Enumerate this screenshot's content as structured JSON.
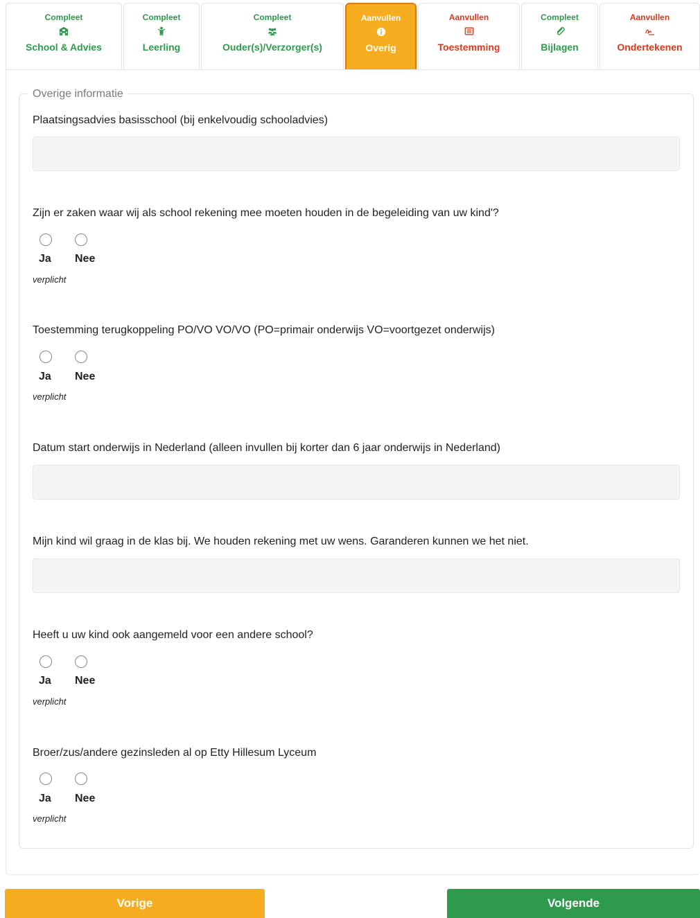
{
  "tabs": [
    {
      "status": "Compleet",
      "label": "School & Advies",
      "icon": "school-icon",
      "state": "done"
    },
    {
      "status": "Compleet",
      "label": "Leerling",
      "icon": "child-icon",
      "state": "done"
    },
    {
      "status": "Compleet",
      "label": "Ouder(s)/Verzorger(s)",
      "icon": "users-icon",
      "state": "done"
    },
    {
      "status": "Aanvullen",
      "label": "Overig",
      "icon": "info-icon",
      "state": "active"
    },
    {
      "status": "Aanvullen",
      "label": "Toestemming",
      "icon": "list-icon",
      "state": "todo"
    },
    {
      "status": "Compleet",
      "label": "Bijlagen",
      "icon": "paperclip-icon",
      "state": "done"
    },
    {
      "status": "Aanvullen",
      "label": "Ondertekenen",
      "icon": "signature-icon",
      "state": "todo"
    }
  ],
  "colors": {
    "done": "#2e9a4c",
    "todo": "#d9391c",
    "active": "#f5ad1f"
  },
  "section": {
    "legend": "Overige informatie"
  },
  "questions": {
    "plaatsingsadvies": "Plaatsingsadvies basisschool (bij enkelvoudig schooladvies)",
    "zaken": "Zijn er zaken waar wij als school rekening mee moeten houden in de begeleiding van uw kind'?",
    "toestemming": "Toestemming terugkoppeling PO/VO VO/VO (PO=primair onderwijs VO=voortgezet onderwijs)",
    "datum": "Datum start onderwijs in Nederland (alleen invullen bij korter dan 6 jaar onderwijs in Nederland)",
    "klas": "Mijn kind wil graag in de klas bij. We houden rekening met uw wens. Garanderen kunnen we het niet.",
    "andere_school": "Heeft u uw kind ook aangemeld voor een andere school?",
    "broer_zus": "Broer/zus/andere gezinsleden al op Etty Hillesum Lyceum"
  },
  "inputs": {
    "plaatsingsadvies": "",
    "datum": "",
    "klas": ""
  },
  "radio": {
    "yes": "Ja",
    "no": "Nee",
    "required": "verplicht"
  },
  "buttons": {
    "prev": "Vorige",
    "next": "Volgende"
  }
}
